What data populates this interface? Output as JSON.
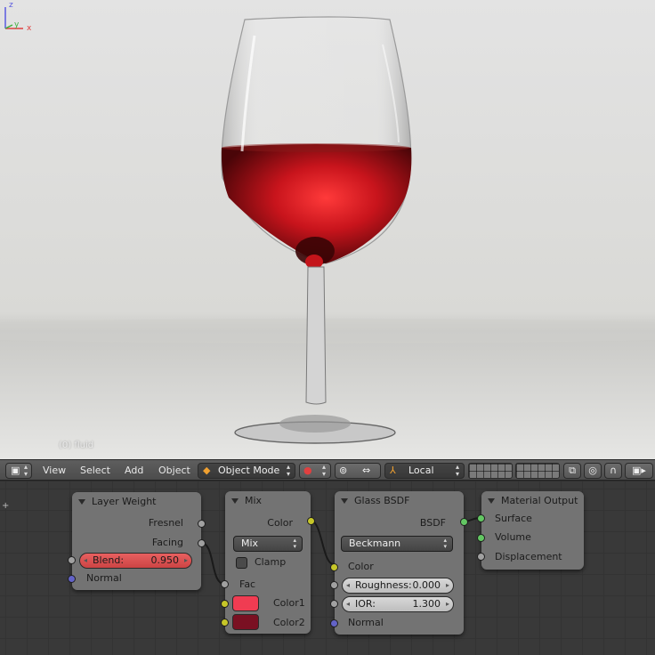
{
  "viewport": {
    "object_label": "(0) fluid",
    "axis": {
      "x": "x",
      "y": "y",
      "z": "z"
    }
  },
  "toolbar": {
    "menu": {
      "view": "View",
      "select": "Select",
      "add": "Add",
      "object": "Object"
    },
    "mode": "Object Mode",
    "orientation": "Local"
  },
  "nodes": {
    "layer_weight": {
      "title": "Layer Weight",
      "out_fresnel": "Fresnel",
      "out_facing": "Facing",
      "blend_label": "Blend:",
      "blend_value": "0.950",
      "in_normal": "Normal"
    },
    "mix": {
      "title": "Mix",
      "out_color": "Color",
      "blend_type": "Mix",
      "clamp_label": "Clamp",
      "in_fac": "Fac",
      "in_color1": "Color1",
      "in_color2": "Color2",
      "color1_hex": "#f03c52",
      "color2_hex": "#7a1022"
    },
    "glass_bsdf": {
      "title": "Glass BSDF",
      "out_bsdf": "BSDF",
      "distribution": "Beckmann",
      "in_color": "Color",
      "roughness_label": "Roughness:",
      "roughness_value": "0.000",
      "ior_label": "IOR:",
      "ior_value": "1.300",
      "in_normal": "Normal"
    },
    "material_output": {
      "title": "Material Output",
      "in_surface": "Surface",
      "in_volume": "Volume",
      "in_displacement": "Displacement"
    }
  },
  "colors": {
    "socket_gray": "#a1a1a1",
    "socket_yellow": "#c7c729",
    "socket_blue": "#6363c7",
    "socket_green": "#63c763",
    "node_body": "#787878",
    "editor_bg": "#393939"
  }
}
